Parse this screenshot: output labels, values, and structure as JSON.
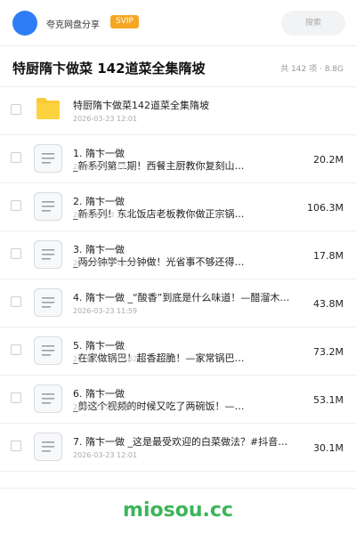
{
  "header": {
    "share_name": "夸克网盘分享",
    "svip_label": "SVIP",
    "search_placeholder": "搜索",
    "accent_color": "#2f7df6"
  },
  "title": {
    "text": "特厨隋卞做菜 142道菜全集隋坡",
    "summary": "共 142 项 · 8.8G"
  },
  "items": [
    {
      "type": "folder",
      "name": "特厨隋卞做菜142道菜全集隋坡",
      "line2": "",
      "date": "2026-03-23 12:01",
      "size": ""
    },
    {
      "type": "file",
      "name": "1. 隋卞一做",
      "line2": "_新系列第二期！西餐主厨教你复刻山…",
      "date": "2026-03-23 12:01",
      "size": "20.2M"
    },
    {
      "type": "file",
      "name": "2. 隋卞一做",
      "line2": "_新系列！东北饭店老板教你做正宗锅…",
      "date": "2026-03-23 12:01",
      "size": "106.3M"
    },
    {
      "type": "file",
      "name": "3. 隋卞一做",
      "line2": "_两分钟学十分钟做！光省事不够还得…",
      "date": "2026-03-23 11:59",
      "size": "17.8M"
    },
    {
      "type": "file",
      "name": "4. 隋卞一做 _“酸香”到底是什么味道！—醋溜木…",
      "line2": "",
      "date": "2026-03-23 11:59",
      "size": "43.8M"
    },
    {
      "type": "file",
      "name": "5. 隋卞一做",
      "line2": "_在家做锅巴！超香超脆！—家常锅巴…",
      "date": "2026-03-23 12:02",
      "size": "73.2M"
    },
    {
      "type": "file",
      "name": "6. 隋卞一做",
      "line2": "_剪这个视频的时候又吃了两碗饭！—…",
      "date": "2026-03-23 12:01",
      "size": "53.1M"
    },
    {
      "type": "file",
      "name": "7. 隋卞一做 _这是最受欢迎的白菜做法？#抖音商…",
      "line2": "",
      "date": "2026-03-23 12:01",
      "size": "30.1M"
    }
  ],
  "footer": {
    "watermark": "miosou.cc"
  }
}
